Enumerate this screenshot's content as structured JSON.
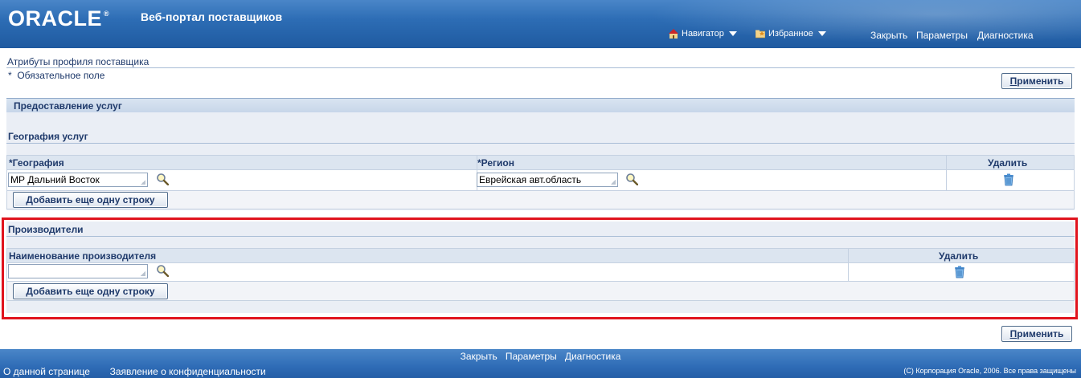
{
  "header": {
    "logo": "ORACLE",
    "logo_mark": "®",
    "app_title": "Веб-портал поставщиков",
    "navigator": "Навигатор",
    "favorites": "Избранное",
    "global_links": [
      "Закрыть",
      "Параметры",
      "Диагностика"
    ]
  },
  "page": {
    "breadcrumb": "Атрибуты профиля поставщика",
    "required_note": "Обязательное поле",
    "required_marker": "*",
    "apply_label_prefix": "П",
    "apply_label_rest": "рименить"
  },
  "services": {
    "header": "Предоставление услуг",
    "geography_title": "География услуг",
    "columns": {
      "geography": "География",
      "region": "Регион",
      "delete": "Удалить"
    },
    "required_marker": "*",
    "row": {
      "geography_value": "МР Дальний Восток",
      "region_value": "Еврейская авт.область"
    },
    "add_row": "Добавить еще одну строку"
  },
  "manufacturers": {
    "title": "Производители",
    "columns": {
      "name": "Наименование производителя",
      "delete": "Удалить"
    },
    "row": {
      "name_value": ""
    },
    "add_row": "Добавить еще одну строку"
  },
  "footer": {
    "links": [
      "Закрыть",
      "Параметры",
      "Диагностика"
    ],
    "about": "О данной странице",
    "privacy": "Заявление о конфиденциальности",
    "copyright": "(C) Корпорация Oracle, 2006. Все права защищены"
  },
  "colors": {
    "header_blue": "#2d6db5",
    "highlight_red": "#e0141e",
    "panel_bg": "#eaeef5"
  }
}
